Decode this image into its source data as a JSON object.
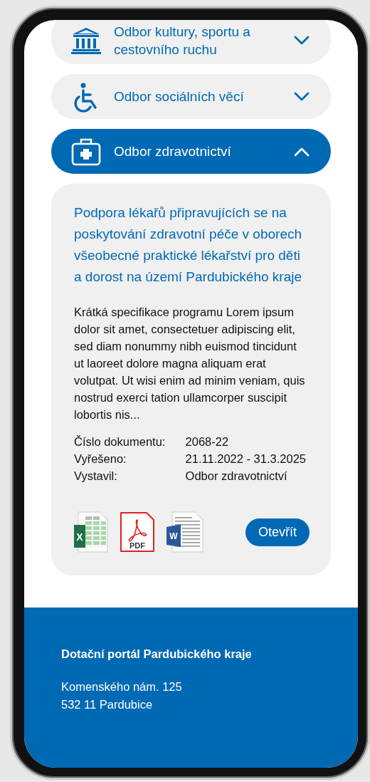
{
  "sections": [
    {
      "label": "Odbor kultury, sportu a cestovního ruchu",
      "expanded": false
    },
    {
      "label": "Odbor sociálních věcí",
      "expanded": false
    },
    {
      "label": "Odbor zdravotnictví",
      "expanded": true,
      "detail": {
        "title": "Podpora lékařů připravujících se na poskytování zdravotní péče v oborech všeobecné praktické lékařství pro děti a dorost na území Pardubického kraje",
        "description": "Krátká specifikace programu Lorem ipsum dolor sit amet, consectetuer adipiscing elit, sed diam nonummy nibh euismod tincidunt ut laoreet dolore magna aliquam erat volutpat. Ut wisi enim ad minim veniam, quis nostrud exerci tation ullamcorper suscipit lobortis nis...",
        "meta": [
          {
            "label": "Číslo dokumentu:",
            "value": "2068-22"
          },
          {
            "label": "Vyřešeno:",
            "value": "21.11.2022 - 31.3.2025"
          },
          {
            "label": "Vystavil:",
            "value": "Odbor zdravotnictví"
          }
        ],
        "files": [
          {
            "kind": "xlsx",
            "mark": "X"
          },
          {
            "kind": "pdf",
            "mark": "PDF"
          },
          {
            "kind": "docx",
            "mark": "W"
          }
        ],
        "button": "Otevřít"
      }
    }
  ],
  "footer": {
    "title": "Dotační portál Pardubického kraje",
    "address": [
      "Komenského nám. 125",
      "532 11 Pardubice"
    ]
  }
}
